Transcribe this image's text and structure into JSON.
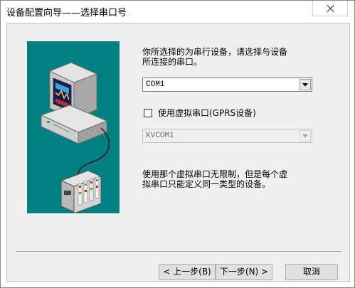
{
  "window": {
    "title": "设备配置向导——选择串口号",
    "close_symbol": "✕"
  },
  "intro": {
    "line1": "你所选择的为串行设备，请选择与设备",
    "line2": "所连接的串口。"
  },
  "port_select": {
    "value": "COM1"
  },
  "virtual_port": {
    "checked": false,
    "label": "使用虚拟串口(GPRS设备)"
  },
  "virtual_select": {
    "value": "KVCOM1",
    "disabled": true
  },
  "note": {
    "line1": "使用那个虚拟串口无限制，但是每个虚",
    "line2": "拟串口只能定义同一类型的设备。"
  },
  "buttons": {
    "back": "< 上一步(B)",
    "next": "下一步(N) >",
    "cancel": "取消"
  },
  "colors": {
    "art_background": "#008080",
    "dialog_background": "#f0f0f0"
  },
  "icons": {
    "close": "close-icon",
    "dropdown": "chevron-down-icon",
    "illustration": "computer-serial-device-illustration"
  }
}
